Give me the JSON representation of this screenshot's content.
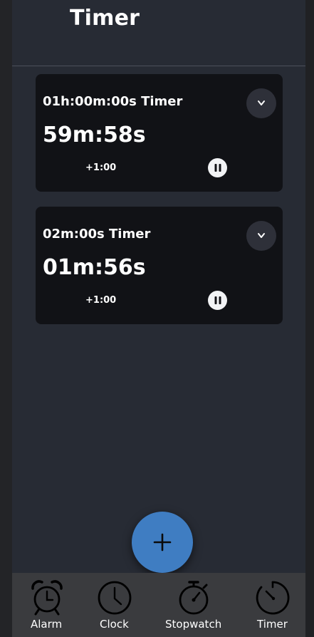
{
  "page": {
    "title": "Timer"
  },
  "timers": [
    {
      "name": "01h:00m:00s Timer",
      "remaining": "59m:58s",
      "add_label": "+1:00",
      "expand_icon": "chevron-down-icon",
      "control_icon": "pause-icon"
    },
    {
      "name": "02m:00s Timer",
      "remaining": "01m:56s",
      "add_label": "+1:00",
      "expand_icon": "chevron-down-icon",
      "control_icon": "pause-icon"
    }
  ],
  "fab": {
    "icon": "plus-icon"
  },
  "nav": {
    "items": [
      {
        "label": "Alarm",
        "icon": "alarm-clock-icon"
      },
      {
        "label": "Clock",
        "icon": "clock-icon"
      },
      {
        "label": "Stopwatch",
        "icon": "stopwatch-icon"
      },
      {
        "label": "Timer",
        "icon": "timer-icon"
      }
    ]
  },
  "colors": {
    "background": "#272b34",
    "card": "#111216",
    "accent": "#3f7dc2",
    "nav_background": "#3a3b3e"
  }
}
